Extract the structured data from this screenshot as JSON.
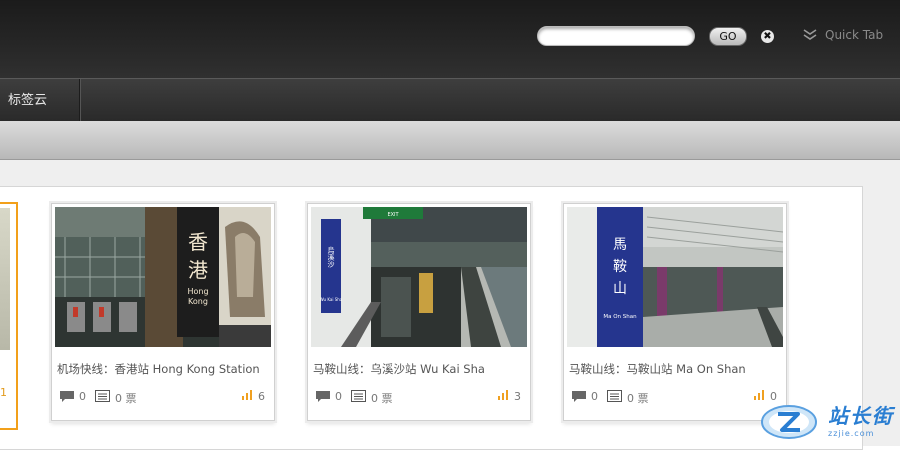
{
  "header": {
    "search_placeholder": "",
    "go_label": "GO",
    "close_symbol": "✖",
    "quicktab_label": "Quick Tab"
  },
  "nav": {
    "items": [
      {
        "label": "标签云"
      }
    ]
  },
  "partial_card": {
    "count": "1"
  },
  "cards": [
    {
      "title": "机场快线：香港站 Hong Kong Station",
      "comments": "0",
      "votes": "0 票",
      "score": "6",
      "photo_sign_zh1": "香",
      "photo_sign_zh2": "港",
      "photo_sign_en1": "Hong",
      "photo_sign_en2": "Kong"
    },
    {
      "title": "马鞍山线：乌溪沙站 Wu Kai Sha",
      "comments": "0",
      "votes": "0 票",
      "score": "3",
      "photo_sign_zh": "烏溪沙",
      "photo_sign_en": "Wu Kai Sha",
      "photo_exit": "EXIT"
    },
    {
      "title": "马鞍山线：马鞍山站 Ma On Shan",
      "comments": "0",
      "votes": "0 票",
      "score": "0",
      "photo_sign_zh1": "馬",
      "photo_sign_zh2": "鞍",
      "photo_sign_zh3": "山",
      "photo_sign_en": "Ma On Shan"
    }
  ],
  "watermark": {
    "text": "站长街",
    "sub": "zzjie.com"
  },
  "colors": {
    "accent_orange": "#f2a01a",
    "sign_blue": "#25358e",
    "logo_blue": "#2a7ed2"
  }
}
